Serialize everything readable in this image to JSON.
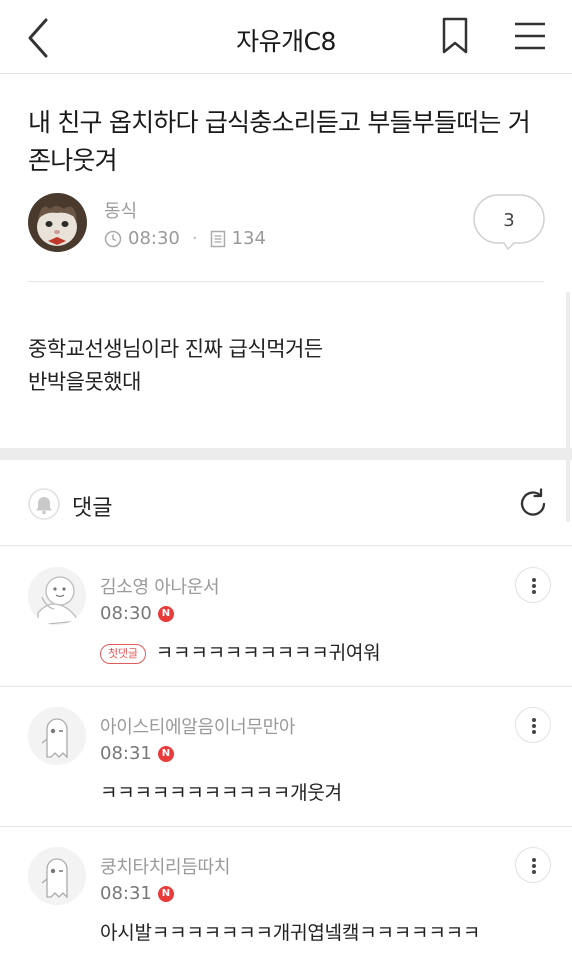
{
  "header": {
    "title": "자유개C8"
  },
  "post": {
    "title": "내 친구 옵치하다 급식충소리듣고 부들부들떠는 거 존나웃겨",
    "author": "동식",
    "time": "08:30",
    "views": "134",
    "comment_count": "3",
    "body_lines": [
      "중학교선생님이라 진짜 급식먹거든",
      "반박을못했대"
    ]
  },
  "comments_section": {
    "label": "댓글"
  },
  "comments": [
    {
      "name": "김소영 아나운서",
      "time": "08:30",
      "new_badge": "N",
      "first_tag": "첫댓글",
      "text": "ㅋㅋㅋㅋㅋㅋㅋㅋㅋㅋ귀여워"
    },
    {
      "name": "아이스티에알음이너무만아",
      "time": "08:31",
      "new_badge": "N",
      "text": "ㅋㅋㅋㅋㅋㅋㅋㅋㅋㅋㅋ개웃겨"
    },
    {
      "name": "쿵치타치리듬따치",
      "time": "08:31",
      "new_badge": "N",
      "text": "아시발ㅋㅋㅋㅋㅋㅋㅋ개귀엽넼캨ㅋㅋㅋㅋㅋㅋㅋ"
    }
  ],
  "colors": {
    "badge_red": "#e83c3c",
    "divider": "#e6e6e6",
    "meta_gray": "#9a9a9a"
  },
  "icons": {
    "back": "chevron-left-icon",
    "bookmark": "bookmark-icon",
    "menu": "hamburger-menu-icon",
    "clock": "clock-icon",
    "views": "document-icon",
    "bell": "bell-icon",
    "refresh": "refresh-icon",
    "more": "more-vertical-icon"
  }
}
